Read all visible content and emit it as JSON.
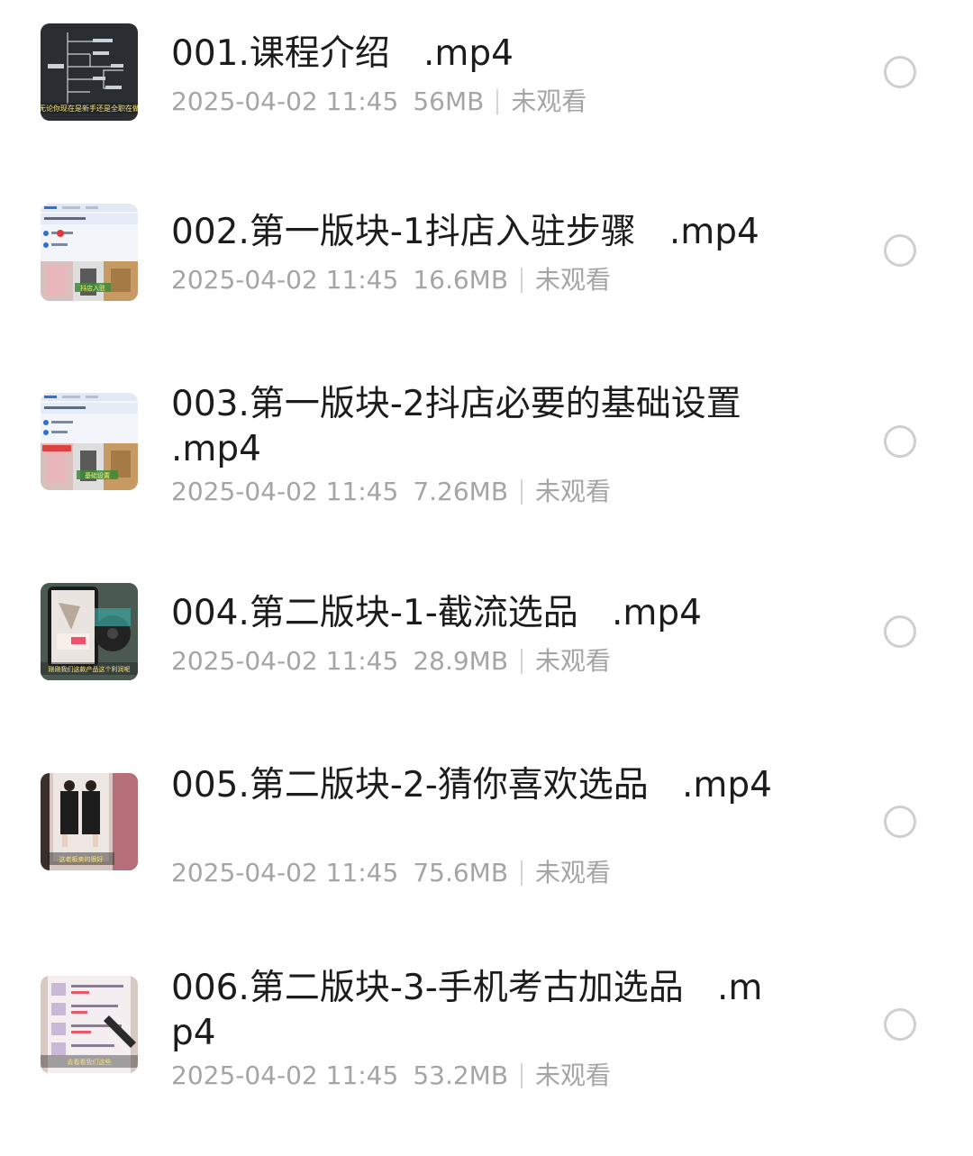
{
  "files": [
    {
      "title": "001.课程介绍   .mp4",
      "date": "2025-04-02 11:45",
      "size": "56MB",
      "status": "未观看",
      "thumbnail": "mindmap-thumbnail",
      "thumb_caption": "无论你现在是新手还是全职在做"
    },
    {
      "title": "002.第一版块-1抖店入驻步骤   .mp4",
      "date": "2025-04-02 11:45",
      "size": "16.6MB",
      "status": "未观看",
      "thumbnail": "shop-dashboard-thumbnail",
      "thumb_caption": "抖店入驻"
    },
    {
      "title": "003.第一版块-2抖店必要的基础设置   .mp4",
      "date": "2025-04-02 11:45",
      "size": "7.26MB",
      "status": "未观看",
      "thumbnail": "shop-dashboard-thumbnail",
      "thumb_caption": "基础设置"
    },
    {
      "title": "004.第二版块-1-截流选品   .mp4",
      "date": "2025-04-02 11:45",
      "size": "28.9MB",
      "status": "未观看",
      "thumbnail": "phone-product-thumbnail",
      "thumb_caption": "刚刚我们这款产品这个利润呢"
    },
    {
      "title": "005.第二版块-2-猜你喜欢选品   .mp4",
      "date": "2025-04-02 11:45",
      "size": "75.6MB",
      "status": "未观看",
      "thumbnail": "phone-fashion-thumbnail",
      "thumb_caption": "这老板卖的很好"
    },
    {
      "title": "006.第二版块-3-手机考古加选品   .mp4",
      "date": "2025-04-02 11:45",
      "size": "53.2MB",
      "status": "未观看",
      "thumbnail": "phone-list-thumbnail",
      "thumb_caption": "去看看我们这些"
    }
  ],
  "colors": {
    "title": "#1c1c1c",
    "meta": "#a5a5a5",
    "divider": "#d4d4d4",
    "circle": "#cfcfcf"
  }
}
